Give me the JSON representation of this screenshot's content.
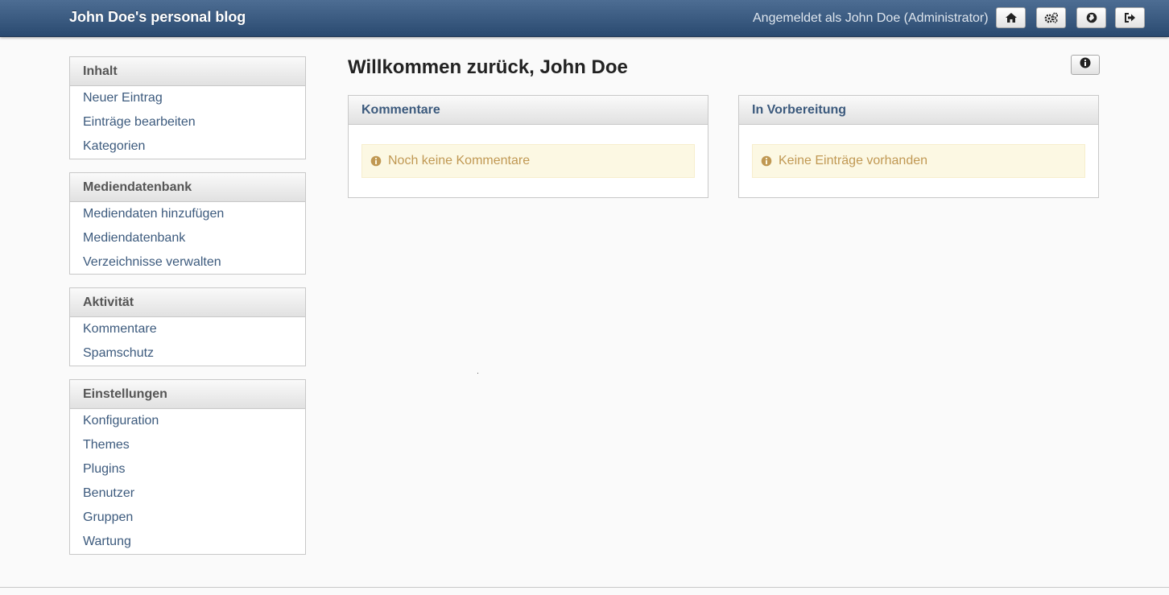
{
  "header": {
    "brand": "John Doe's personal blog",
    "user_info": "Angemeldet als John Doe (Administrator)",
    "buttons": [
      {
        "icon": "home-icon"
      },
      {
        "icon": "gears-icon"
      },
      {
        "icon": "globe-icon"
      },
      {
        "icon": "logout-icon"
      }
    ]
  },
  "sidebar": {
    "sections": [
      {
        "title": "Inhalt",
        "items": [
          "Neuer Eintrag",
          "Einträge bearbeiten",
          "Kategorien"
        ]
      },
      {
        "title": "Mediendatenbank",
        "items": [
          "Mediendaten hinzufügen",
          "Mediendatenbank",
          "Verzeichnisse verwalten"
        ]
      },
      {
        "title": "Aktivität",
        "items": [
          "Kommentare",
          "Spamschutz"
        ]
      },
      {
        "title": "Einstellungen",
        "items": [
          "Konfiguration",
          "Themes",
          "Plugins",
          "Benutzer",
          "Gruppen",
          "Wartung"
        ]
      }
    ]
  },
  "main": {
    "title": "Willkommen zurück, John Doe",
    "info_icon": "info-icon",
    "panels": [
      {
        "title": "Kommentare",
        "message": "Noch keine Kommentare"
      },
      {
        "title": "In Vorbereitung",
        "message": "Keine Einträge vorhanden"
      }
    ]
  },
  "colors": {
    "header_top": "#4d6d93",
    "header_bottom": "#2a4a70",
    "link": "#3c5a7d",
    "alert_bg": "#fcf8e3",
    "alert_text": "#c09853"
  }
}
